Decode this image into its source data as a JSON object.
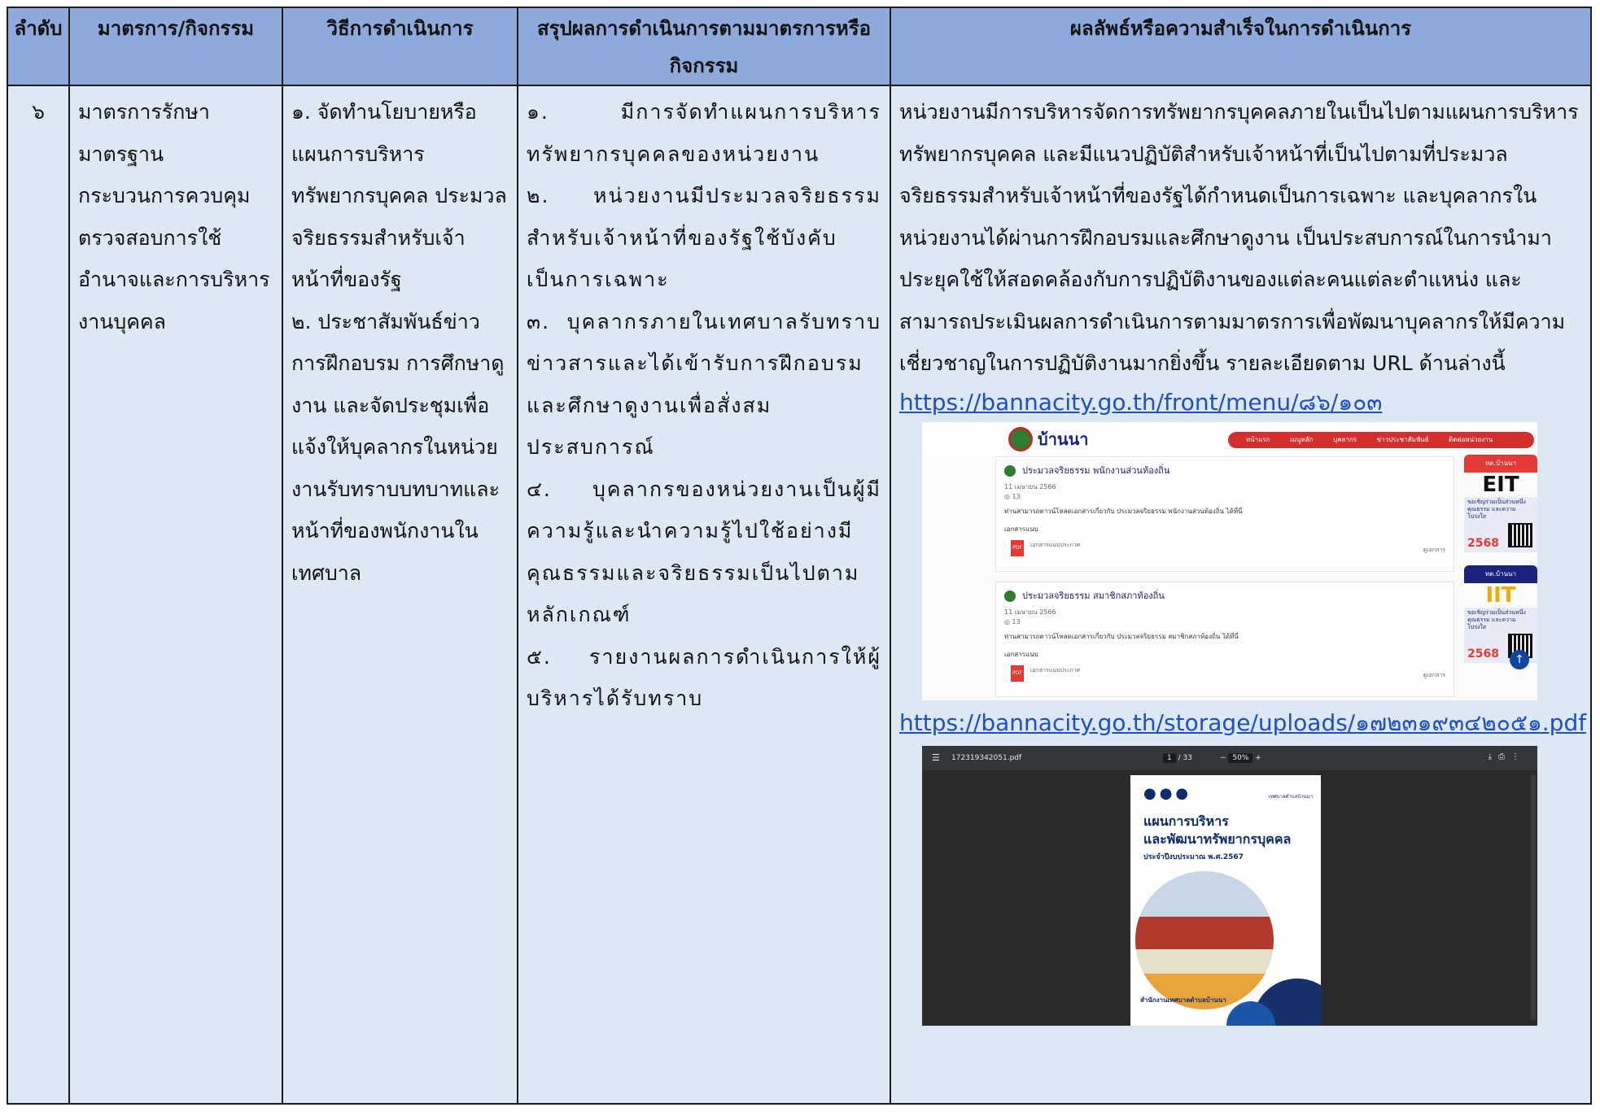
{
  "table": {
    "headers": [
      "ลำดับ",
      "มาตรการ/กิจกรรม",
      "วิธีการดำเนินการ",
      "สรุปผลการดำเนินการตามมาตรการหรือกิจกรรม",
      "ผลลัพธ์หรือความสำเร็จในการดำเนินการ"
    ],
    "row": {
      "number": "๖",
      "measure": "มาตรการรักษามาตรฐาน กระบวนการควบคุม ตรวจสอบการใช้อำนาจและการบริหารงานบุคคล",
      "methods": [
        "๑. จัดทำนโยบายหรือแผนการบริหารทรัพยากรบุคคล ประมวลจริยธรรมสำหรับเจ้าหน้าที่ของรัฐ",
        "๒. ประชาสัมพันธ์ข่าวการฝึกอบรม การศึกษาดูงาน และจัดประชุมเพื่อแจ้งให้บุคลากรในหน่วยงานรับทราบบทบาทและหน้าที่ของพนักงานในเทศบาล"
      ],
      "summary": [
        "๑. มีการจัดทำแผนการบริหารทรัพยากรบุคคลของหน่วยงาน",
        "๒. หน่วยงานมีประมวลจริยธรรมสำหรับเจ้าหน้าที่ของรัฐใช้บังคับเป็นการเฉพาะ",
        "๓. บุคลากรภายในเทศบาลรับทราบข่าวสารและได้เข้ารับการฝึกอบรมและศึกษาดูงานเพื่อสั่งสมประสบการณ์",
        "๔. บุคลากรของหน่วยงานเป็นผู้มีความรู้และนำความรู้ไปใช้อย่างมีคุณธรรมและจริยธรรมเป็นไปตามหลักเกณฑ์",
        "๕. รายงานผลการดำเนินการให้ผู้บริหารได้รับทราบ"
      ],
      "result_text": "หน่วยงานมีการบริหารจัดการทรัพยากรบุคคลภายในเป็นไปตามแผนการบริหารทรัพยากรบุคคล และมีแนวปฏิบัติสำหรับเจ้าหน้าที่เป็นไปตามที่ประมวลจริยธรรมสำหรับเจ้าหน้าที่ของรัฐได้กำหนดเป็นการเฉพาะ และบุคลากรในหน่วยงานได้ผ่านการฝึกอบรมและศึกษาดูงาน เป็นประสบการณ์ในการนำมาประยุคใช้ให้สอดคล้องกับการปฏิบัติงานของแต่ละคนแต่ละตำแหน่ง และสามารถประเมินผลการดำเนินการตามมาตรการเพื่อพัฒนาบุคลากรให้มีความเชี่ยวชาญในการปฏิบัติงานมากยิ่งขึ้น รายละเอียดตาม URL ด้านล่างนี้",
      "url1": "https://bannacity.go.th/front/menu/๘๖/๑๐๓",
      "url2": "https://bannacity.go.th/storage/uploads/๑๗๒๓๑๙๓๔๒๐๕๑.pdf"
    }
  },
  "screenshot_website": {
    "logo_text": "บ้านนา",
    "menu": [
      "หน้าแรก",
      "เมนูหลัก",
      "บุคลากร",
      "ข่าวประชาสัมพันธ์",
      "ติดต่อหน่วยงาน"
    ],
    "cards": [
      {
        "title": "ประมวลจริยธรรม พนักงานส่วนท้องถิ่น",
        "date": "11 เมษายน 2566",
        "views": "13",
        "desc": "ท่านสามารถดาวน์โหลดเอกสารเกี่ยวกับ ประมวลจริยธรรม พนักงานส่วนท้องถิ่น ได้ที่นี่",
        "doc_label": "เอกสารแนบ",
        "file": "เอกสารแนบประกาศ",
        "view_link": "ดูเอกสาร"
      },
      {
        "title": "ประมวลจริยธรรม สมาชิกสภาท้องถิ่น",
        "date": "11 เมษายน 2566",
        "views": "13",
        "desc": "ท่านสามารถดาวน์โหลดเอกสารเกี่ยวกับ ประมวลจริยธรรม สมาชิกสภาท้องถิ่น ได้ที่นี่",
        "doc_label": "เอกสารแนบ",
        "file": "เอกสารแนบประกาศ",
        "view_link": "ดูเอกสาร"
      }
    ],
    "badges": [
      {
        "top": "ทต.บ้านนา",
        "big": "EIT",
        "body": "ขอเชิญร่วมเป็นส่วนหนึ่ง คุณธรรม และความโปร่งใส",
        "year": "2568",
        "big_color": "#111111",
        "top_color": "#e53935"
      },
      {
        "top": "ทต.บ้านนา",
        "big": "IIT",
        "body": "ขอเชิญร่วมเป็นส่วนหนึ่ง คุณธรรม และความโปร่งใส",
        "year": "2568",
        "big_color": "#f2a900",
        "top_color": "#1a237e"
      }
    ]
  },
  "screenshot_pdf": {
    "file_name": "172319342051.pdf",
    "page_current": "1",
    "page_total": "/ 33",
    "zoom": "50%",
    "org": "เทศบาลตำบลบ้านนา",
    "title1": "แผนการบริหาร",
    "title2": "และพัฒนาทรัพยากรบุคคล",
    "title3": "ประจำปีงบประมาณ พ.ศ.2567",
    "office": "สำนักงานเทศบาลตำบลบ้านนา"
  },
  "colors": {
    "header_bg": "#8eaadb",
    "body_bg": "#dde8f5",
    "link": "#1f4fc4"
  }
}
